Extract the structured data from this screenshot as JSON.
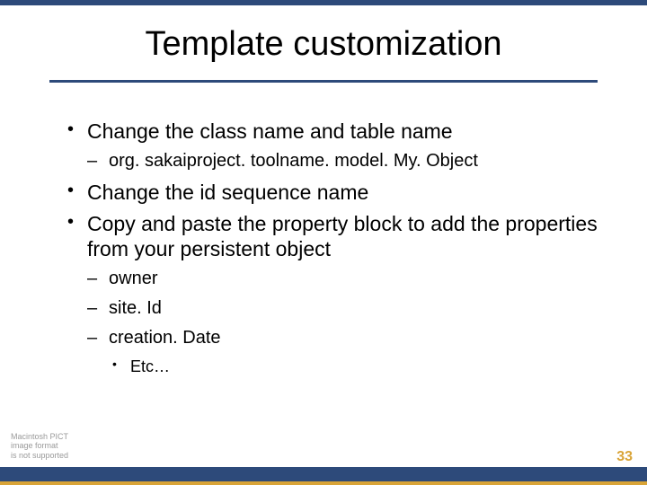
{
  "title": "Template customization",
  "bullets": {
    "b1": "Change the class name and table name",
    "b1_sub1": "org. sakaiproject. toolname. model. My. Object",
    "b2": "Change the id sequence name",
    "b3": "Copy and paste the property block to add the properties from your persistent object",
    "b3_sub1": "owner",
    "b3_sub2": "site. Id",
    "b3_sub3": "creation. Date",
    "b3_sub3_sub1": "Etc…"
  },
  "placeholder": {
    "line1": "Macintosh PICT",
    "line2": "image format",
    "line3": "is not supported"
  },
  "page_number": "33"
}
